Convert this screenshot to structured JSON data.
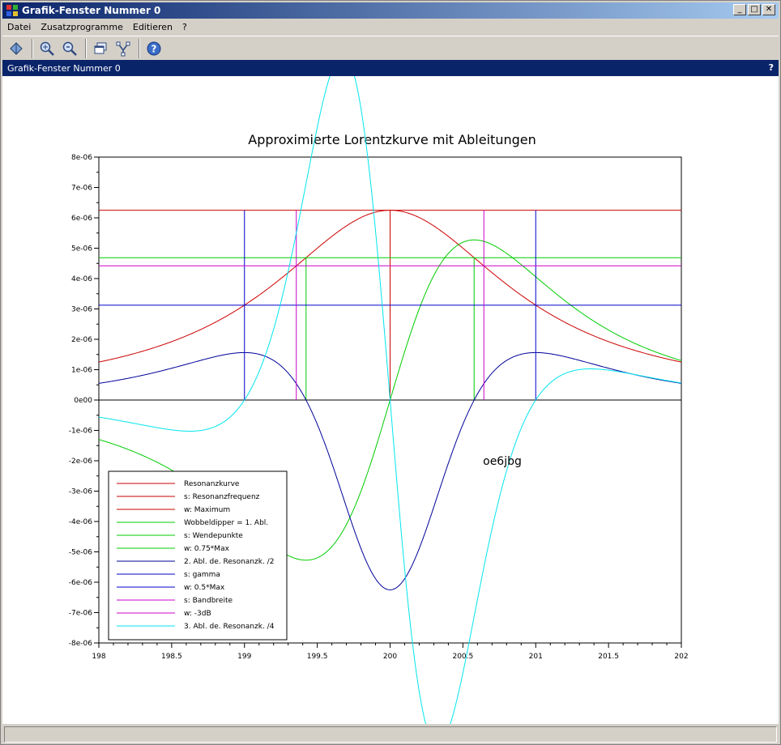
{
  "window": {
    "title": "Grafik-Fenster Nummer 0",
    "btn_min": "_",
    "btn_max": "□",
    "btn_close": "✕"
  },
  "menu": {
    "items": [
      "Datei",
      "Zusatzprogramme",
      "Editieren",
      "?"
    ]
  },
  "subheader": {
    "title": "Grafik-Fenster Nummer 0",
    "help": "?"
  },
  "chart_data": {
    "type": "line",
    "title": "Approximierte Lorentzkurve mit Ableitungen",
    "xlim": [
      198,
      202
    ],
    "ylim": [
      -8e-06,
      8e-06
    ],
    "x_ticks": [
      "198",
      "198.5",
      "199",
      "199.5",
      "200",
      "200.5",
      "201",
      "201.5",
      "202"
    ],
    "y_ticks": [
      "8e-06",
      "7e-06",
      "6e-06",
      "5e-06",
      "4e-06",
      "3e-06",
      "2e-06",
      "1e-06",
      "0e00",
      "-1e-06",
      "-2e-06",
      "-3e-06",
      "-4e-06",
      "-5e-06",
      "-6e-06",
      "-7e-06",
      "-8e-06"
    ],
    "annotation": "oe6jbg",
    "grid": false,
    "legend_position": "bottom-left",
    "lorentz": {
      "center": 200,
      "gamma": 1,
      "peak": 6.25e-06
    },
    "series": [
      {
        "name": "Resonanzkurve",
        "color": "#cc0000",
        "kind": "lorentz"
      },
      {
        "name": "s: Resonanzfrequenz",
        "color": "#cc0000",
        "kind": "vline",
        "x": 200,
        "y": 6.25e-06
      },
      {
        "name": "w: Maximum",
        "color": "#cc0000",
        "kind": "hline",
        "y": 6.25e-06
      },
      {
        "name": "Wobbeldipper = 1. Abl.",
        "color": "#00cc00",
        "kind": "deriv1"
      },
      {
        "name": "s: Wendepunkte",
        "color": "#00cc00",
        "kind": "vlines",
        "xs": [
          199.423,
          200.577
        ],
        "y": 4.6875e-06
      },
      {
        "name": "w: 0.75*Max",
        "color": "#00cc00",
        "kind": "hline",
        "y": 4.6875e-06
      },
      {
        "name": "2. Abl. de. Resonanzk. /2",
        "color": "#000099",
        "kind": "deriv2"
      },
      {
        "name": "s: gamma",
        "color": "#0000cc",
        "kind": "vlines",
        "xs": [
          199,
          201
        ],
        "y": 6.25e-06
      },
      {
        "name": "w: 0.5*Max",
        "color": "#0000cc",
        "kind": "hline",
        "y": 3.125e-06
      },
      {
        "name": "s: Bandbreite",
        "color": "#cc00cc",
        "kind": "vlines",
        "xs": [
          199.356,
          200.644
        ],
        "y": 6.25e-06
      },
      {
        "name": "w: -3dB",
        "color": "#cc00cc",
        "kind": "hline",
        "y": 4.419e-06
      },
      {
        "name": "3. Abl. de. Resonanzk. /4",
        "color": "#00e5ee",
        "kind": "deriv3"
      }
    ]
  }
}
